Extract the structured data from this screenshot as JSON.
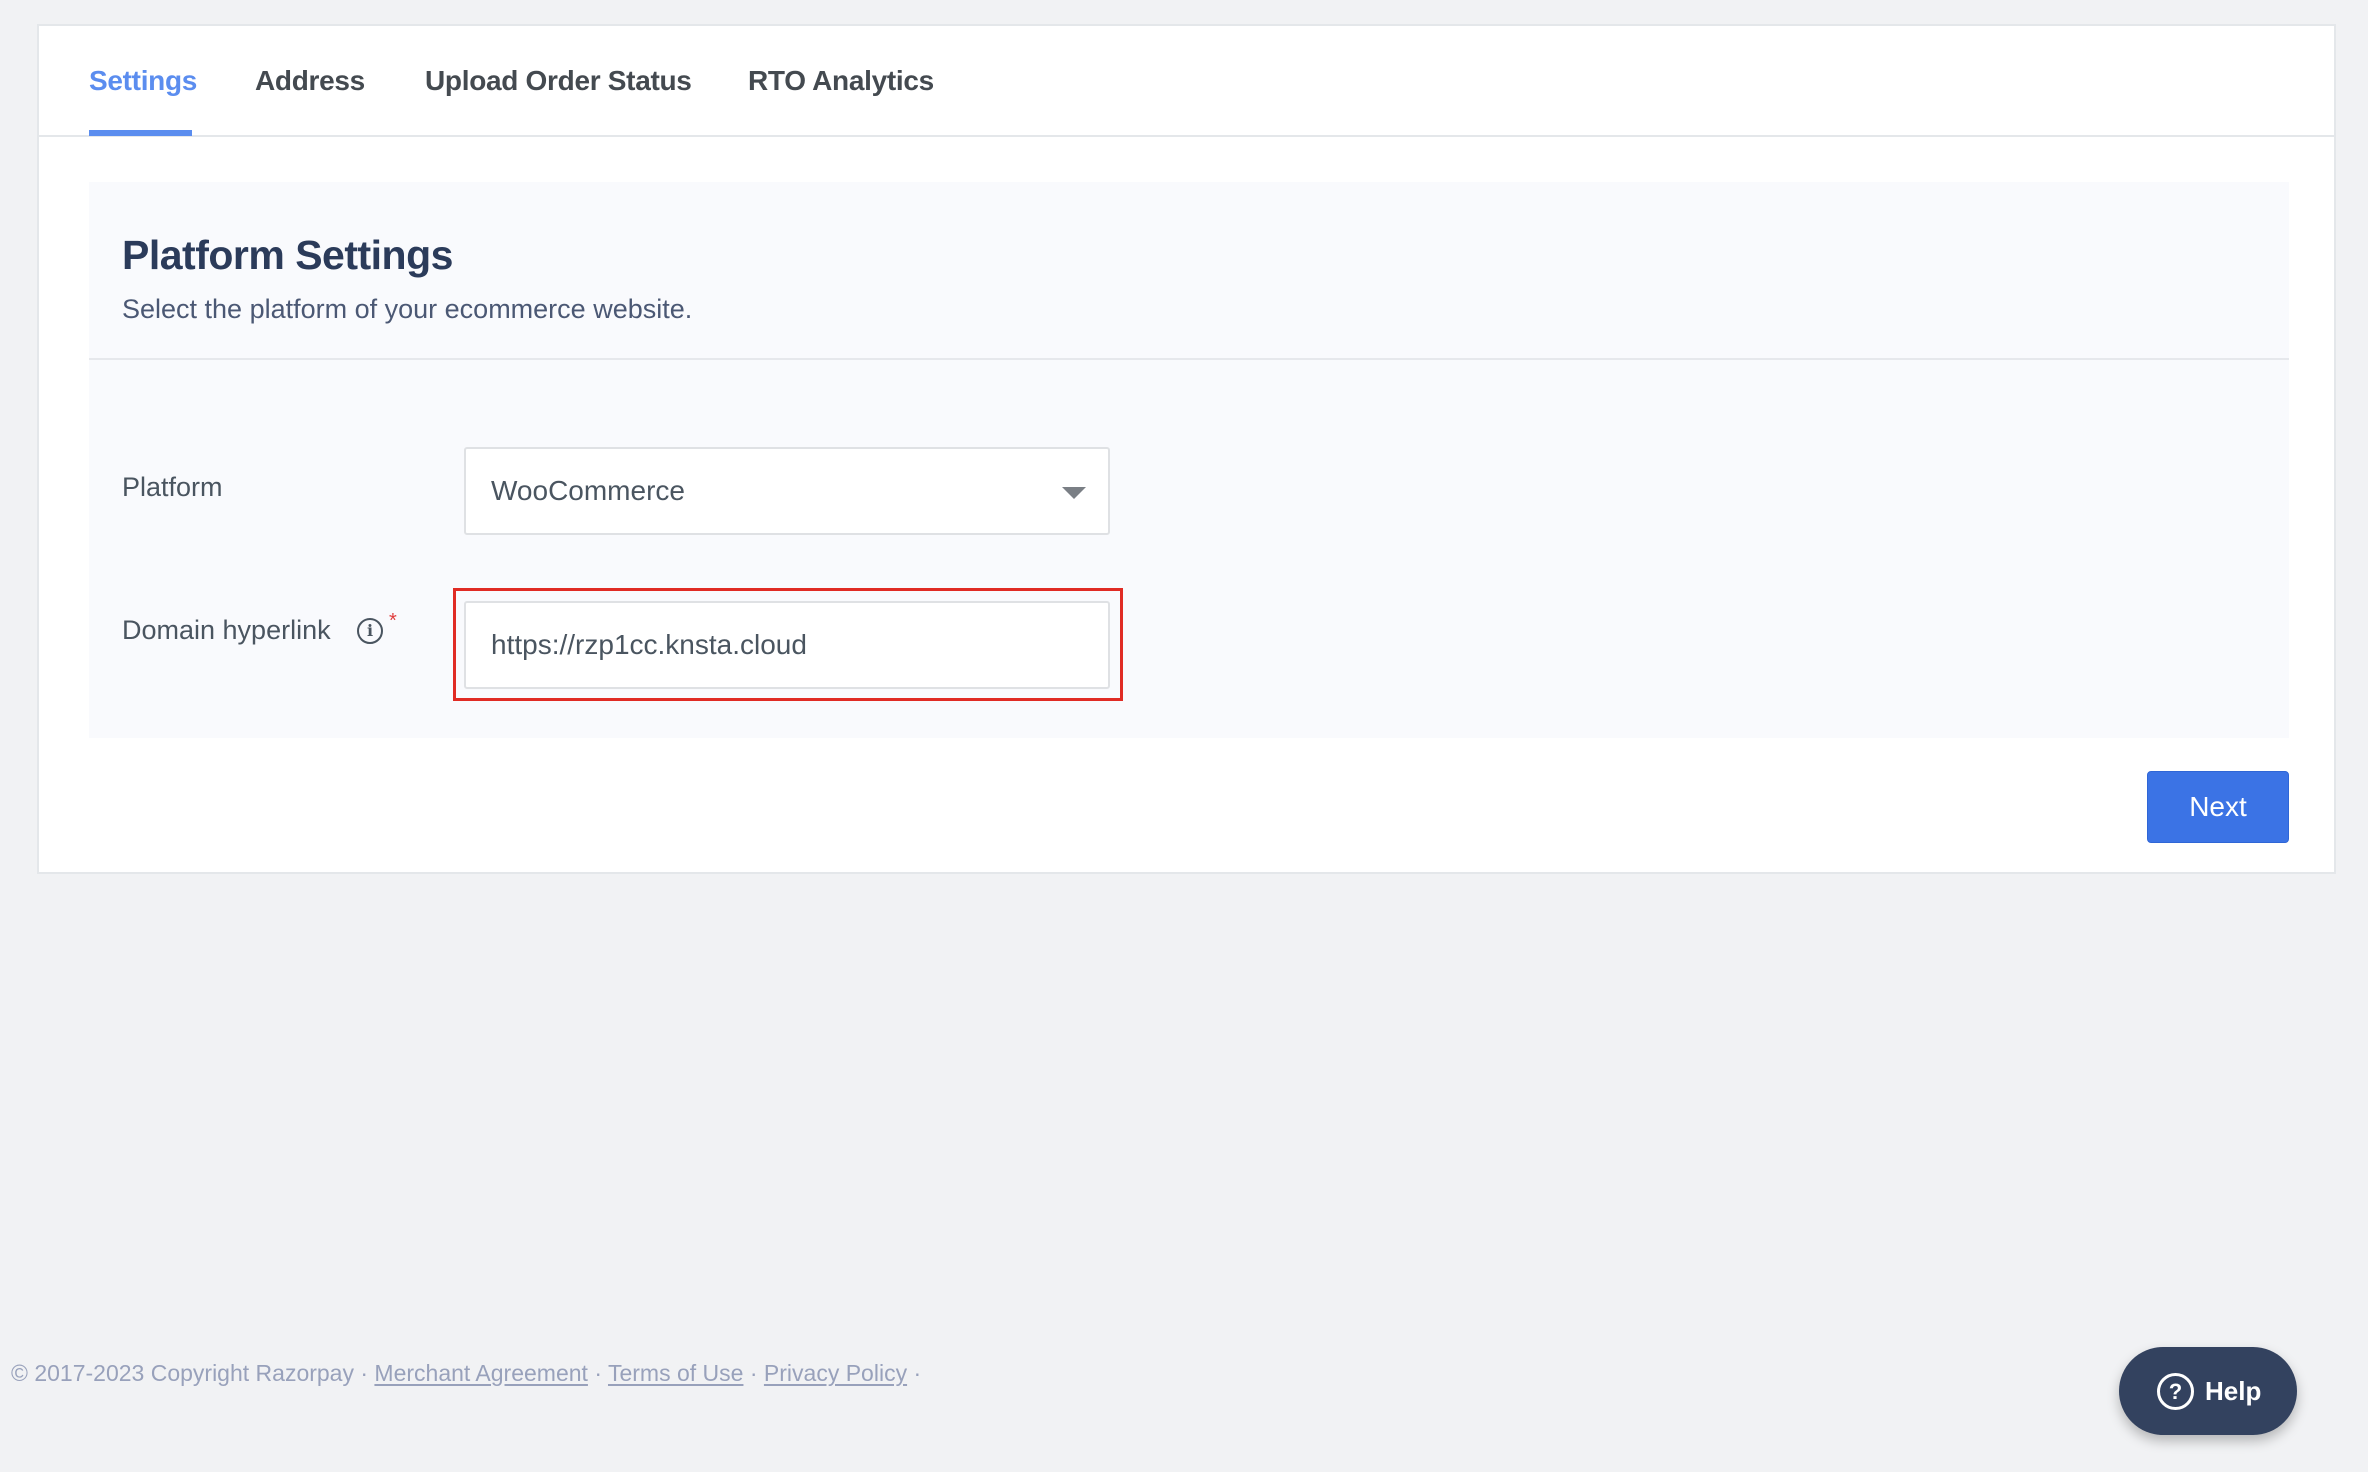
{
  "tabs": [
    {
      "label": "Settings",
      "active": true
    },
    {
      "label": "Address",
      "active": false
    },
    {
      "label": "Upload Order Status",
      "active": false
    },
    {
      "label": "RTO Analytics",
      "active": false
    }
  ],
  "panel": {
    "title": "Platform Settings",
    "subtitle": "Select the platform of your ecommerce website."
  },
  "form": {
    "platform": {
      "label": "Platform",
      "value": "WooCommerce",
      "icon": "caret-down-icon"
    },
    "domain": {
      "label": "Domain hyperlink",
      "value": "https://rzp1cc.knsta.cloud",
      "info_icon": "info-icon",
      "required_mark": "*"
    }
  },
  "actions": {
    "next_label": "Next"
  },
  "footer": {
    "copyright": "© 2017-2023 Copyright Razorpay ·",
    "links": [
      "Merchant Agreement",
      "Terms of Use",
      "Privacy Policy"
    ],
    "separator": "·"
  },
  "help": {
    "label": "Help",
    "icon_glyph": "?"
  },
  "colors": {
    "accent": "#5b8def",
    "primary_button": "#3b73e5",
    "help_button": "#33425f",
    "highlight": "#e02b24"
  }
}
